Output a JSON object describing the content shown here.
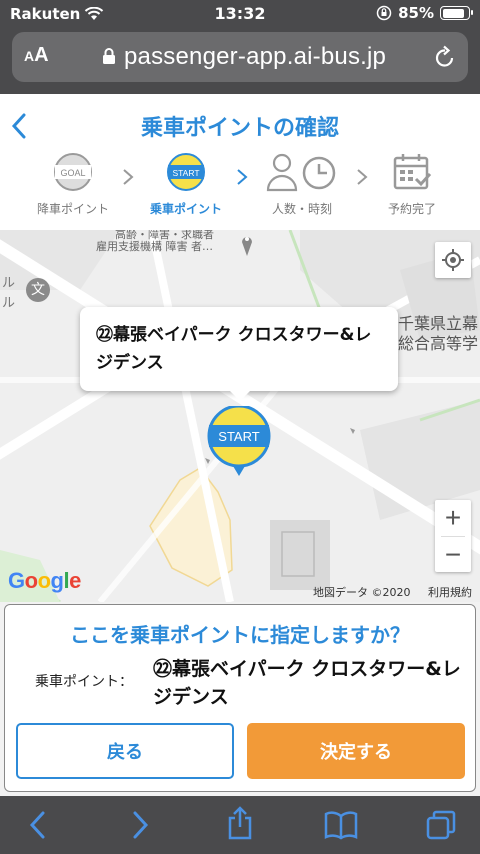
{
  "status_bar": {
    "carrier": "Rakuten",
    "time": "13:32",
    "battery": "85%",
    "battery_level": 0.85
  },
  "browser": {
    "text_size_label": "AA",
    "url": "passenger-app.ai-bus.jp"
  },
  "header": {
    "title": "乗車ポイントの確認",
    "steps": [
      {
        "label": "降車ポイント",
        "badge": "GOAL"
      },
      {
        "label": "乗車ポイント",
        "badge": "START"
      },
      {
        "label": "人数・時刻"
      },
      {
        "label": "予約完了"
      }
    ],
    "active_step": 1
  },
  "map": {
    "popup_text": "㉒幕張ベイパーク クロスタワー&レジデンス",
    "pin_label": "START",
    "google_logo": "Google",
    "attribution": "地図データ ©2020",
    "terms_link": "利用規約",
    "labels": {
      "top_text_1": "高齢・障害・求職者",
      "top_text_2": "雇用支援機構 障害 者…",
      "right_text_1": "千葉県立幕",
      "right_text_2": "総合高等学",
      "left_text": "ル",
      "left_text_2": "ル",
      "school_icon": "文"
    },
    "zoom_in": "+",
    "zoom_out": "−"
  },
  "confirm": {
    "question": "ここを乗車ポイントに指定しますか？",
    "point_label": "乗車ポイント：",
    "point_value": "㉒幕張ベイパーク クロスタワー&レジデンス",
    "back_button": "戻る",
    "ok_button": "決定する"
  },
  "colors": {
    "accent_blue": "#2c8ad8",
    "accent_orange": "#f29a38",
    "pin_yellow": "#f5e04a"
  }
}
